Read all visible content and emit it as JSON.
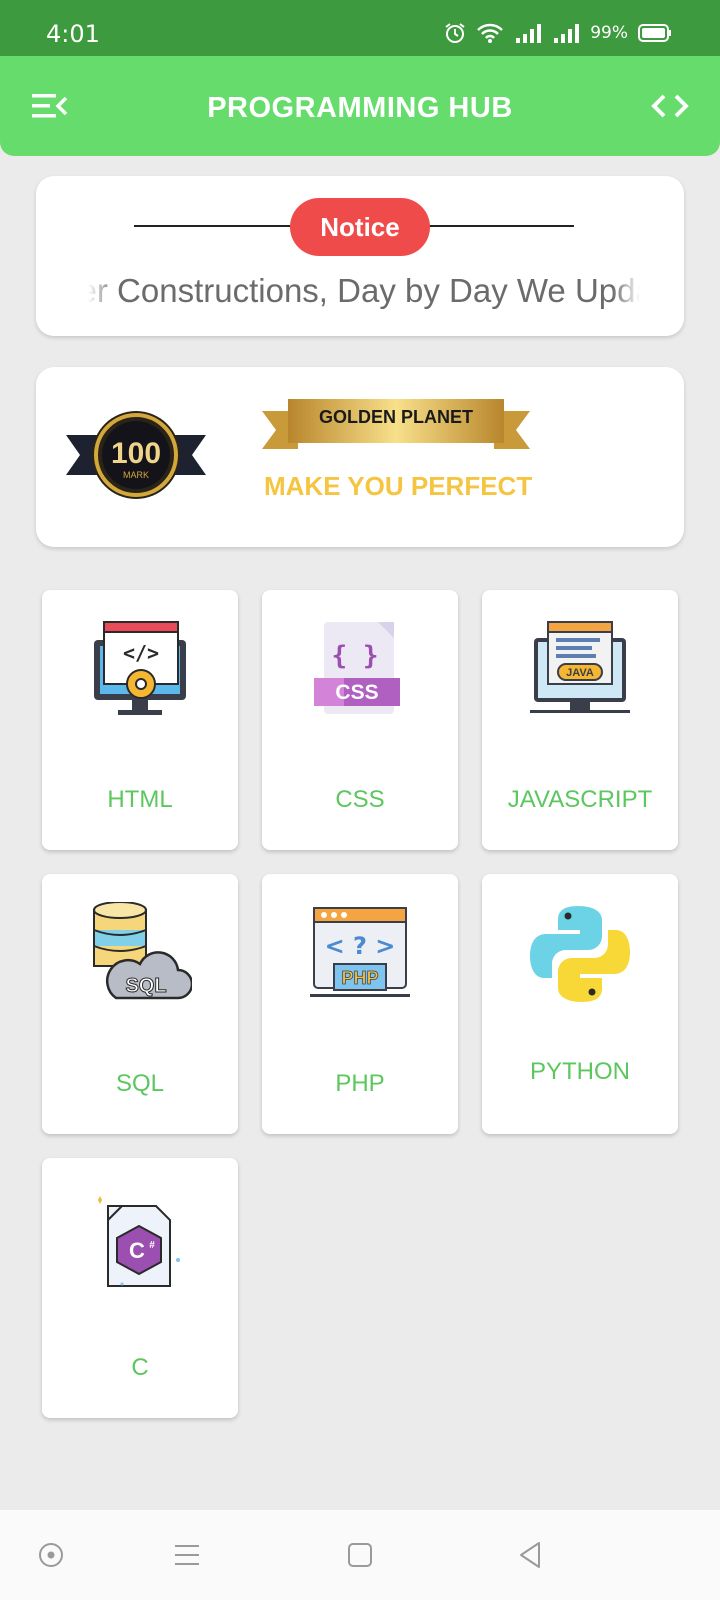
{
  "status_bar": {
    "time": "4:01",
    "battery": "99%",
    "icons": [
      "alarm-icon",
      "wifi-icon",
      "signal-icon",
      "signal-icon",
      "battery-icon"
    ]
  },
  "app_bar": {
    "title": "PROGRAMMING HUB",
    "menu_icon": "menu-collapse-icon",
    "action_icon": "code-brackets-icon",
    "color": "#65dc6b"
  },
  "notice": {
    "label": "Notice",
    "text": "Under Constructions, Day by Day We Update",
    "pill_color": "#f04b4b"
  },
  "banner": {
    "badge_number": "100",
    "badge_sub": "MARK",
    "ribbon_text": "GOLDEN PLANET",
    "tagline": "MAKE YOU PERFECT"
  },
  "courses": [
    {
      "label": "HTML",
      "icon": "html-monitor-icon"
    },
    {
      "label": "CSS",
      "icon": "css-file-icon"
    },
    {
      "label": "JAVASCRIPT",
      "icon": "java-monitor-icon"
    },
    {
      "label": "SQL",
      "icon": "sql-database-icon"
    },
    {
      "label": "PHP",
      "icon": "php-window-icon"
    },
    {
      "label": "PYTHON",
      "icon": "python-logo-icon"
    },
    {
      "label": "C",
      "icon": "csharp-file-icon"
    }
  ],
  "colors": {
    "status_bar": "#3e9a3e",
    "label_green": "#5cc75f",
    "background": "#ebebeb"
  },
  "nav_bar": {
    "icons": [
      "assistant-icon",
      "recents-icon",
      "home-icon",
      "back-icon"
    ]
  }
}
